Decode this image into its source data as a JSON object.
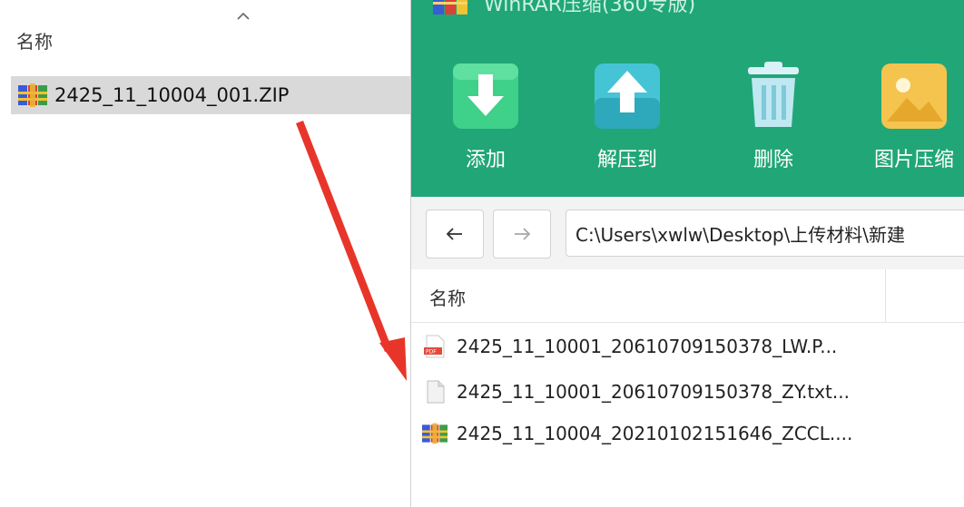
{
  "explorer": {
    "header": "名称",
    "sort_icon": "chevron-up-icon",
    "selected_file": "2425_11_10004_001.ZIP"
  },
  "app": {
    "title": "WinRAR压缩(360专版)",
    "toolbar": [
      {
        "label": "添加",
        "icon": "add-icon"
      },
      {
        "label": "解压到",
        "icon": "extract-icon"
      },
      {
        "label": "删除",
        "icon": "delete-icon"
      },
      {
        "label": "图片压缩",
        "icon": "image-compress-icon"
      }
    ],
    "nav": {
      "back": "←",
      "forward": "→"
    },
    "path": "C:\\Users\\xwlw\\Desktop\\上传材料\\新建",
    "column_name": "名称",
    "files": [
      {
        "name": "2425_11_10001_20610709150378_LW.P...",
        "type": "pdf"
      },
      {
        "name": "2425_11_10001_20610709150378_ZY.txt...",
        "type": "txt"
      },
      {
        "name": "2425_11_10004_20210102151646_ZCCL....",
        "type": "archive"
      }
    ]
  },
  "colors": {
    "toolbar_bg": "#21a678",
    "arrow": "#e8352a"
  }
}
